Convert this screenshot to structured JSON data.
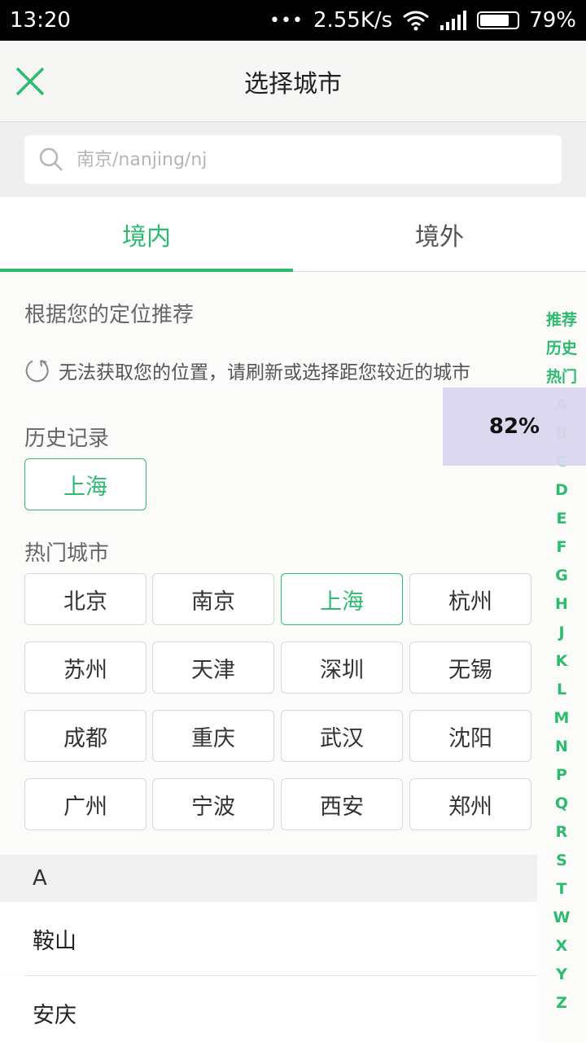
{
  "status_bar": {
    "time": "13:20",
    "dots": "•••",
    "speed": "2.55K/s",
    "battery": "79%",
    "battery_level": 0.79
  },
  "header": {
    "title": "选择城市"
  },
  "search": {
    "placeholder": "南京/nanjing/nj",
    "value": ""
  },
  "tabs": [
    {
      "label": "境内",
      "active": true
    },
    {
      "label": "境外",
      "active": false
    }
  ],
  "recommend": {
    "title": "根据您的定位推荐",
    "location_message": "无法获取您的位置，请刷新或选择距您较近的城市"
  },
  "history": {
    "title": "历史记录",
    "cities": [
      "上海"
    ]
  },
  "hot": {
    "title": "热门城市",
    "cities": [
      "北京",
      "南京",
      "上海",
      "杭州",
      "苏州",
      "天津",
      "深圳",
      "无锡",
      "成都",
      "重庆",
      "武汉",
      "沈阳",
      "广州",
      "宁波",
      "西安",
      "郑州"
    ],
    "selected": "上海"
  },
  "index_bar": [
    "推荐",
    "历史",
    "热门",
    "A",
    "B",
    "C",
    "D",
    "E",
    "F",
    "G",
    "H",
    "J",
    "K",
    "L",
    "M",
    "N",
    "P",
    "Q",
    "R",
    "S",
    "T",
    "W",
    "X",
    "Y",
    "Z"
  ],
  "toast": {
    "text": "82%"
  },
  "city_list": {
    "letter": "A",
    "items": [
      "鞍山",
      "安庆"
    ]
  },
  "colors": {
    "accent": "#2dbb6f",
    "toast_bg": "#d8d5ee"
  },
  "icons": [
    "close-icon",
    "search-icon",
    "refresh-icon",
    "wifi-icon",
    "signal-icon",
    "battery-icon"
  ]
}
